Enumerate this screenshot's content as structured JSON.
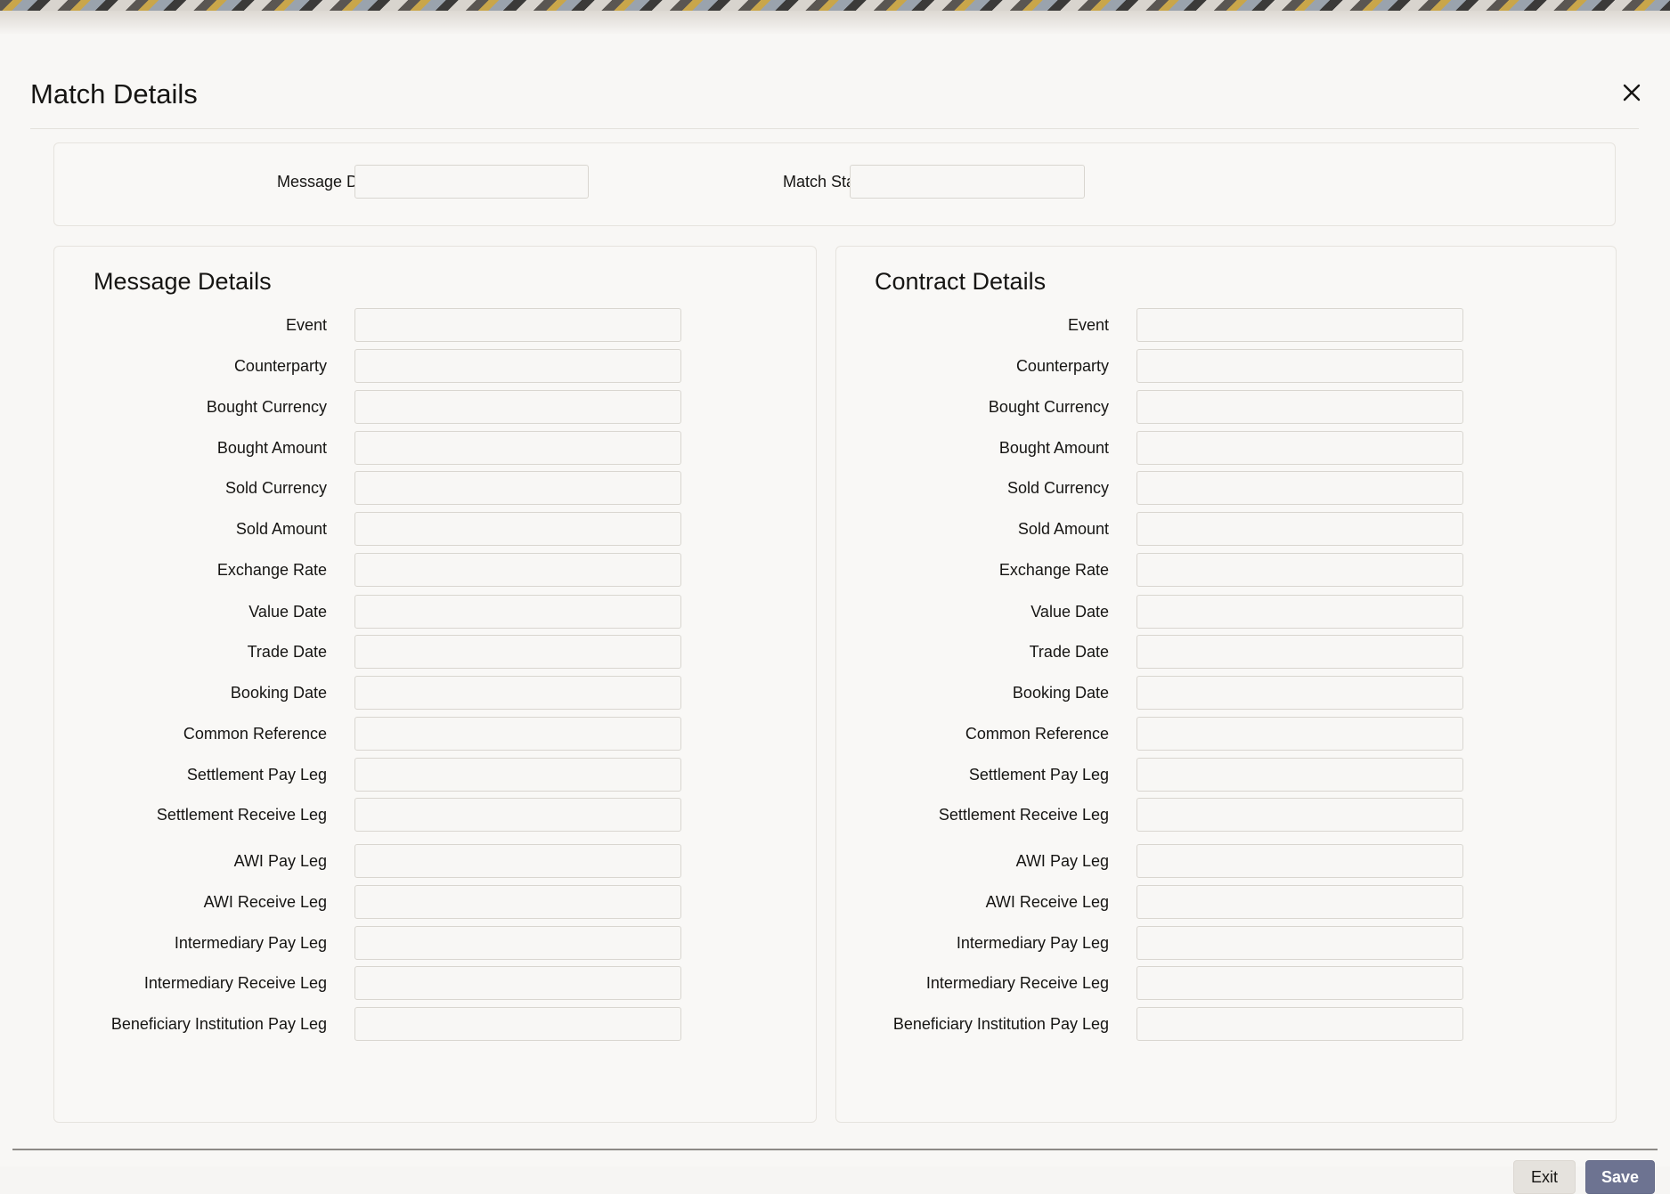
{
  "dialog": {
    "title": "Match Details",
    "close_icon": "close-icon"
  },
  "header_fields": {
    "message_dcn": {
      "label": "Message DCN",
      "value": ""
    },
    "match_status": {
      "label": "Match Status",
      "value": ""
    }
  },
  "message_details": {
    "title": "Message Details",
    "fields": [
      {
        "label": "Event",
        "value": ""
      },
      {
        "label": "Counterparty",
        "value": ""
      },
      {
        "label": "Bought Currency",
        "value": ""
      },
      {
        "label": "Bought Amount",
        "value": ""
      },
      {
        "label": "Sold Currency",
        "value": ""
      },
      {
        "label": "Sold Amount",
        "value": ""
      },
      {
        "label": "Exchange Rate",
        "value": ""
      },
      {
        "label": "Value Date",
        "value": ""
      },
      {
        "label": "Trade Date",
        "value": ""
      },
      {
        "label": "Booking Date",
        "value": ""
      },
      {
        "label": "Common Reference",
        "value": ""
      },
      {
        "label": "Settlement Pay Leg",
        "value": ""
      },
      {
        "label": "Settlement Receive Leg",
        "value": ""
      },
      {
        "label": "AWI Pay Leg",
        "value": ""
      },
      {
        "label": "AWI Receive Leg",
        "value": ""
      },
      {
        "label": "Intermediary Pay Leg",
        "value": ""
      },
      {
        "label": "Intermediary Receive Leg",
        "value": ""
      },
      {
        "label": "Beneficiary Institution Pay Leg",
        "value": ""
      }
    ]
  },
  "contract_details": {
    "title": "Contract Details",
    "fields": [
      {
        "label": "Event",
        "value": ""
      },
      {
        "label": "Counterparty",
        "value": ""
      },
      {
        "label": "Bought Currency",
        "value": ""
      },
      {
        "label": "Bought Amount",
        "value": ""
      },
      {
        "label": "Sold Currency",
        "value": ""
      },
      {
        "label": "Sold Amount",
        "value": ""
      },
      {
        "label": "Exchange Rate",
        "value": ""
      },
      {
        "label": "Value Date",
        "value": ""
      },
      {
        "label": "Trade Date",
        "value": ""
      },
      {
        "label": "Booking Date",
        "value": ""
      },
      {
        "label": "Common Reference",
        "value": ""
      },
      {
        "label": "Settlement Pay Leg",
        "value": ""
      },
      {
        "label": "Settlement Receive Leg",
        "value": ""
      },
      {
        "label": "AWI Pay Leg",
        "value": ""
      },
      {
        "label": "AWI Receive Leg",
        "value": ""
      },
      {
        "label": "Intermediary Pay Leg",
        "value": ""
      },
      {
        "label": "Intermediary Receive Leg",
        "value": ""
      },
      {
        "label": "Beneficiary Institution Pay Leg",
        "value": ""
      }
    ]
  },
  "footer": {
    "exit_label": "Exit",
    "save_label": "Save"
  },
  "colors": {
    "save_button": "#6d7391",
    "exit_button": "#e5e2dd"
  }
}
